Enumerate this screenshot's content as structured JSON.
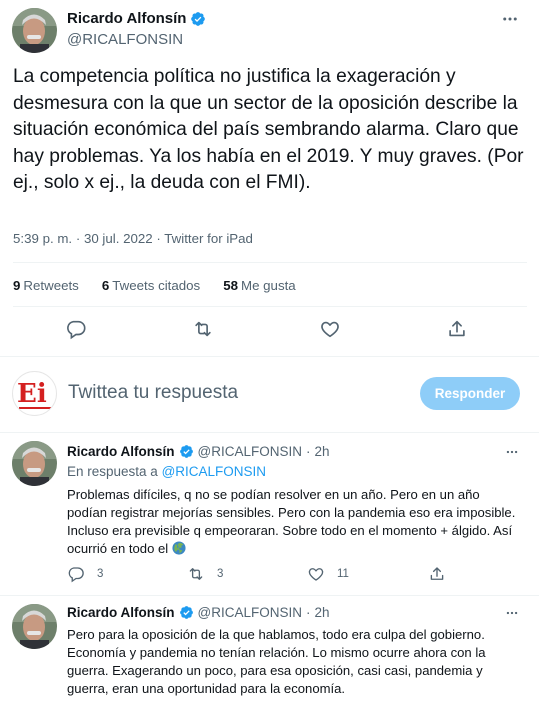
{
  "main_tweet": {
    "author_name": "Ricardo Alfonsín",
    "author_handle": "@RICALFONSIN",
    "text": "La competencia política no justifica la exageración y desmesura con la que un sector de la oposición describe la situación económica del país sembrando alarma. Claro que hay problemas. Ya los había en el 2019. Y muy graves. (Por ej., solo x ej., la deuda con el FMI).",
    "meta": "5:39 p. m. · 30 jul. 2022 · Twitter for iPad",
    "stats": {
      "retweets_count": "9",
      "retweets_label": "Retweets",
      "quotes_count": "6",
      "quotes_label": "Tweets citados",
      "likes_count": "58",
      "likes_label": "Me gusta"
    }
  },
  "reply_box": {
    "logo_text": "Ei",
    "placeholder": "Twittea tu respuesta",
    "button_label": "Responder"
  },
  "thread": [
    {
      "author_name": "Ricardo Alfonsín",
      "author_handle": "@RICALFONSIN",
      "dot": "·",
      "time": "2h",
      "replying_prefix": "En respuesta a",
      "replying_handle": "@RICALFONSIN",
      "text": "Problemas difíciles, q no se podían resolver en un año. Pero en un año podían registrar mejorías sensibles. Pero con la pandemia eso era imposible. Incluso era previsible q empeoraran. Sobre todo en el momento + álgido. Así ocurrió en todo el",
      "replies": "3",
      "retweets": "3",
      "likes": "11"
    },
    {
      "author_name": "Ricardo Alfonsín",
      "author_handle": "@RICALFONSIN",
      "dot": "·",
      "time": "2h",
      "text": "Pero para la  oposición de la que hablamos, todo era culpa del gobierno. Economía y pandemia  no tenían relación. Lo mismo ocurre ahora con la guerra. Exagerando un poco, para esa oposición, casi casi, pandemia y guerra, eran una oportunidad para la economía."
    }
  ],
  "icons": {
    "verified": "verified-badge-icon",
    "more": "more-icon",
    "reply": "reply-icon",
    "retweet": "retweet-icon",
    "like": "like-icon",
    "share": "share-icon",
    "globe": "globe-emoji-icon"
  },
  "colors": {
    "accent": "#1d9bf0",
    "secondary_text": "#536471",
    "button_disabled": "#8ecdf8",
    "divider": "#eff3f4"
  }
}
